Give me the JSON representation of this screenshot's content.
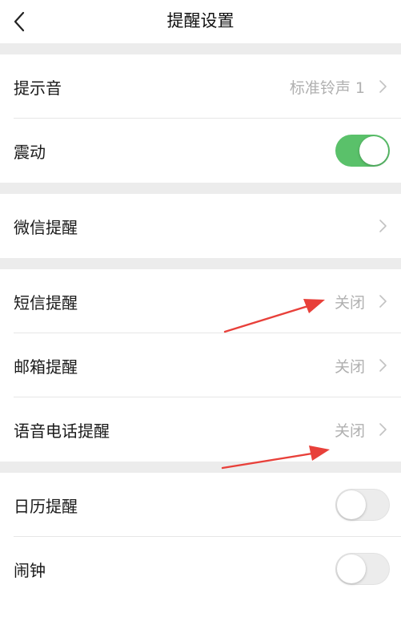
{
  "header": {
    "title": "提醒设置",
    "back_icon": "chevron-left-icon"
  },
  "rows": {
    "ringtone": {
      "label": "提示音",
      "value": "标准铃声 1"
    },
    "vibrate": {
      "label": "震动",
      "enabled": true
    },
    "wechat": {
      "label": "微信提醒"
    },
    "sms": {
      "label": "短信提醒",
      "value": "关闭"
    },
    "mail": {
      "label": "邮箱提醒",
      "value": "关闭"
    },
    "voice_call": {
      "label": "语音电话提醒",
      "value": "关闭"
    },
    "calendar": {
      "label": "日历提醒",
      "enabled": false
    },
    "alarm": {
      "label": "闹钟",
      "enabled": false
    }
  },
  "colors": {
    "toggle_on": "#5ac16a",
    "toggle_off": "#ececec",
    "section_gap": "#ececec",
    "annotation_arrow": "#e8403a"
  }
}
